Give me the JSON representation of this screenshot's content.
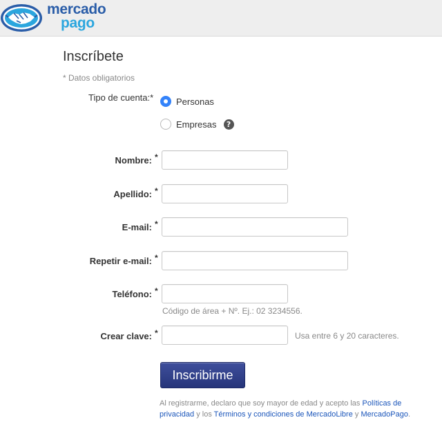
{
  "brand": {
    "line1": "mercado",
    "line2": "pago",
    "colors": {
      "primary": "#2a5da8",
      "secondary": "#2ba6de"
    }
  },
  "page": {
    "title": "Inscríbete",
    "required_note": "* Datos obligatorios"
  },
  "account_type": {
    "label": "Tipo de cuenta:*",
    "options": [
      {
        "label": "Personas",
        "selected": true
      },
      {
        "label": "Empresas",
        "selected": false
      }
    ]
  },
  "fields": {
    "nombre": {
      "label": "Nombre:",
      "star": "*",
      "value": ""
    },
    "apellido": {
      "label": "Apellido:",
      "star": "*",
      "value": ""
    },
    "email": {
      "label": "E-mail:",
      "star": "*",
      "value": ""
    },
    "repeat_email": {
      "label": "Repetir e-mail:",
      "star": "*",
      "value": ""
    },
    "telefono": {
      "label": "Teléfono:",
      "star": "*",
      "value": "",
      "hint": "Código de área + Nº. Ej.: 02 3234556."
    },
    "clave": {
      "label": "Crear clave:",
      "star": "*",
      "value": "",
      "hint": "Usa entre 6 y 20 caracteres."
    }
  },
  "submit": {
    "label": "Inscribirme"
  },
  "legal": {
    "pre": "Al registrarme, declaro que soy mayor de edad y acepto las ",
    "privacy_link": "Políticas de privacidad",
    "mid": " y los ",
    "terms_link": "Términos y condiciones de MercadoLibre",
    "and": " y ",
    "mp_link": "MercadoPago",
    "end": "."
  },
  "accent_colors": {
    "radio": "#3483fa",
    "button": "#2d3c87",
    "link": "#1a55ba"
  }
}
